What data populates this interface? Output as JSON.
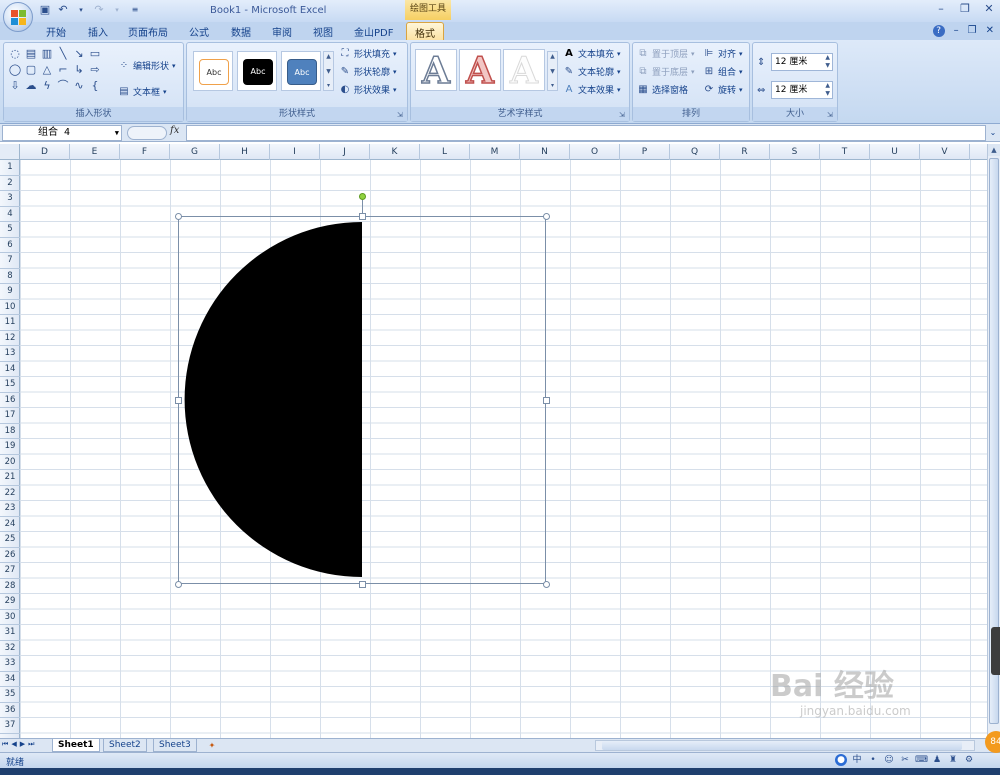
{
  "window": {
    "title": "Book1 - Microsoft Excel",
    "context_tab_title": "绘图工具"
  },
  "ribbon_tabs": [
    "开始",
    "插入",
    "页面布局",
    "公式",
    "数据",
    "审阅",
    "视图",
    "金山PDF",
    "格式"
  ],
  "active_tab": "格式",
  "ribbon": {
    "insert_shapes": {
      "label": "插入形状",
      "edit_shape": "编辑形状",
      "text_box": "文本框"
    },
    "shape_styles": {
      "label": "形状样式",
      "swatches": [
        "Abc",
        "Abc",
        "Abc"
      ],
      "fill": "形状填充",
      "outline": "形状轮廓",
      "effects": "形状效果"
    },
    "wordart_styles": {
      "label": "艺术字样式",
      "letters": [
        "A",
        "A",
        "A"
      ],
      "text_fill": "文本填充",
      "text_outline": "文本轮廓",
      "text_effects": "文本效果"
    },
    "arrange": {
      "label": "排列",
      "bring_front": "置于顶层",
      "send_back": "置于底层",
      "selection_pane": "选择窗格",
      "align": "对齐",
      "group": "组合",
      "rotate": "旋转"
    },
    "size": {
      "label": "大小",
      "height": "12 厘米",
      "width": "12 厘米"
    }
  },
  "formula_bar": {
    "name_box": "组合 4",
    "fx": "fx",
    "formula": ""
  },
  "columns": [
    "D",
    "E",
    "F",
    "G",
    "H",
    "I",
    "J",
    "K",
    "L",
    "M",
    "N",
    "O",
    "P",
    "Q",
    "R",
    "S",
    "T",
    "U",
    "V"
  ],
  "rows": [
    "1",
    "2",
    "3",
    "4",
    "5",
    "6",
    "7",
    "8",
    "9",
    "10",
    "11",
    "12",
    "13",
    "14",
    "15",
    "16",
    "17",
    "18",
    "19",
    "20",
    "21",
    "22",
    "23",
    "24",
    "25",
    "26",
    "27",
    "28",
    "29",
    "30",
    "31",
    "32",
    "33",
    "34",
    "35",
    "36",
    "37"
  ],
  "sheets": [
    "Sheet1",
    "Sheet2",
    "Sheet3"
  ],
  "active_sheet": "Sheet1",
  "status": "就绪",
  "ime_labels": [
    "中"
  ],
  "watermark": {
    "main": "Bai 经验",
    "sub": "jingyan.baidu.com"
  },
  "badge": "84",
  "colors": {
    "shape_fill": "#000000",
    "selection_border": "#7b8fa8",
    "rotation_handle": "#8fd13f"
  }
}
